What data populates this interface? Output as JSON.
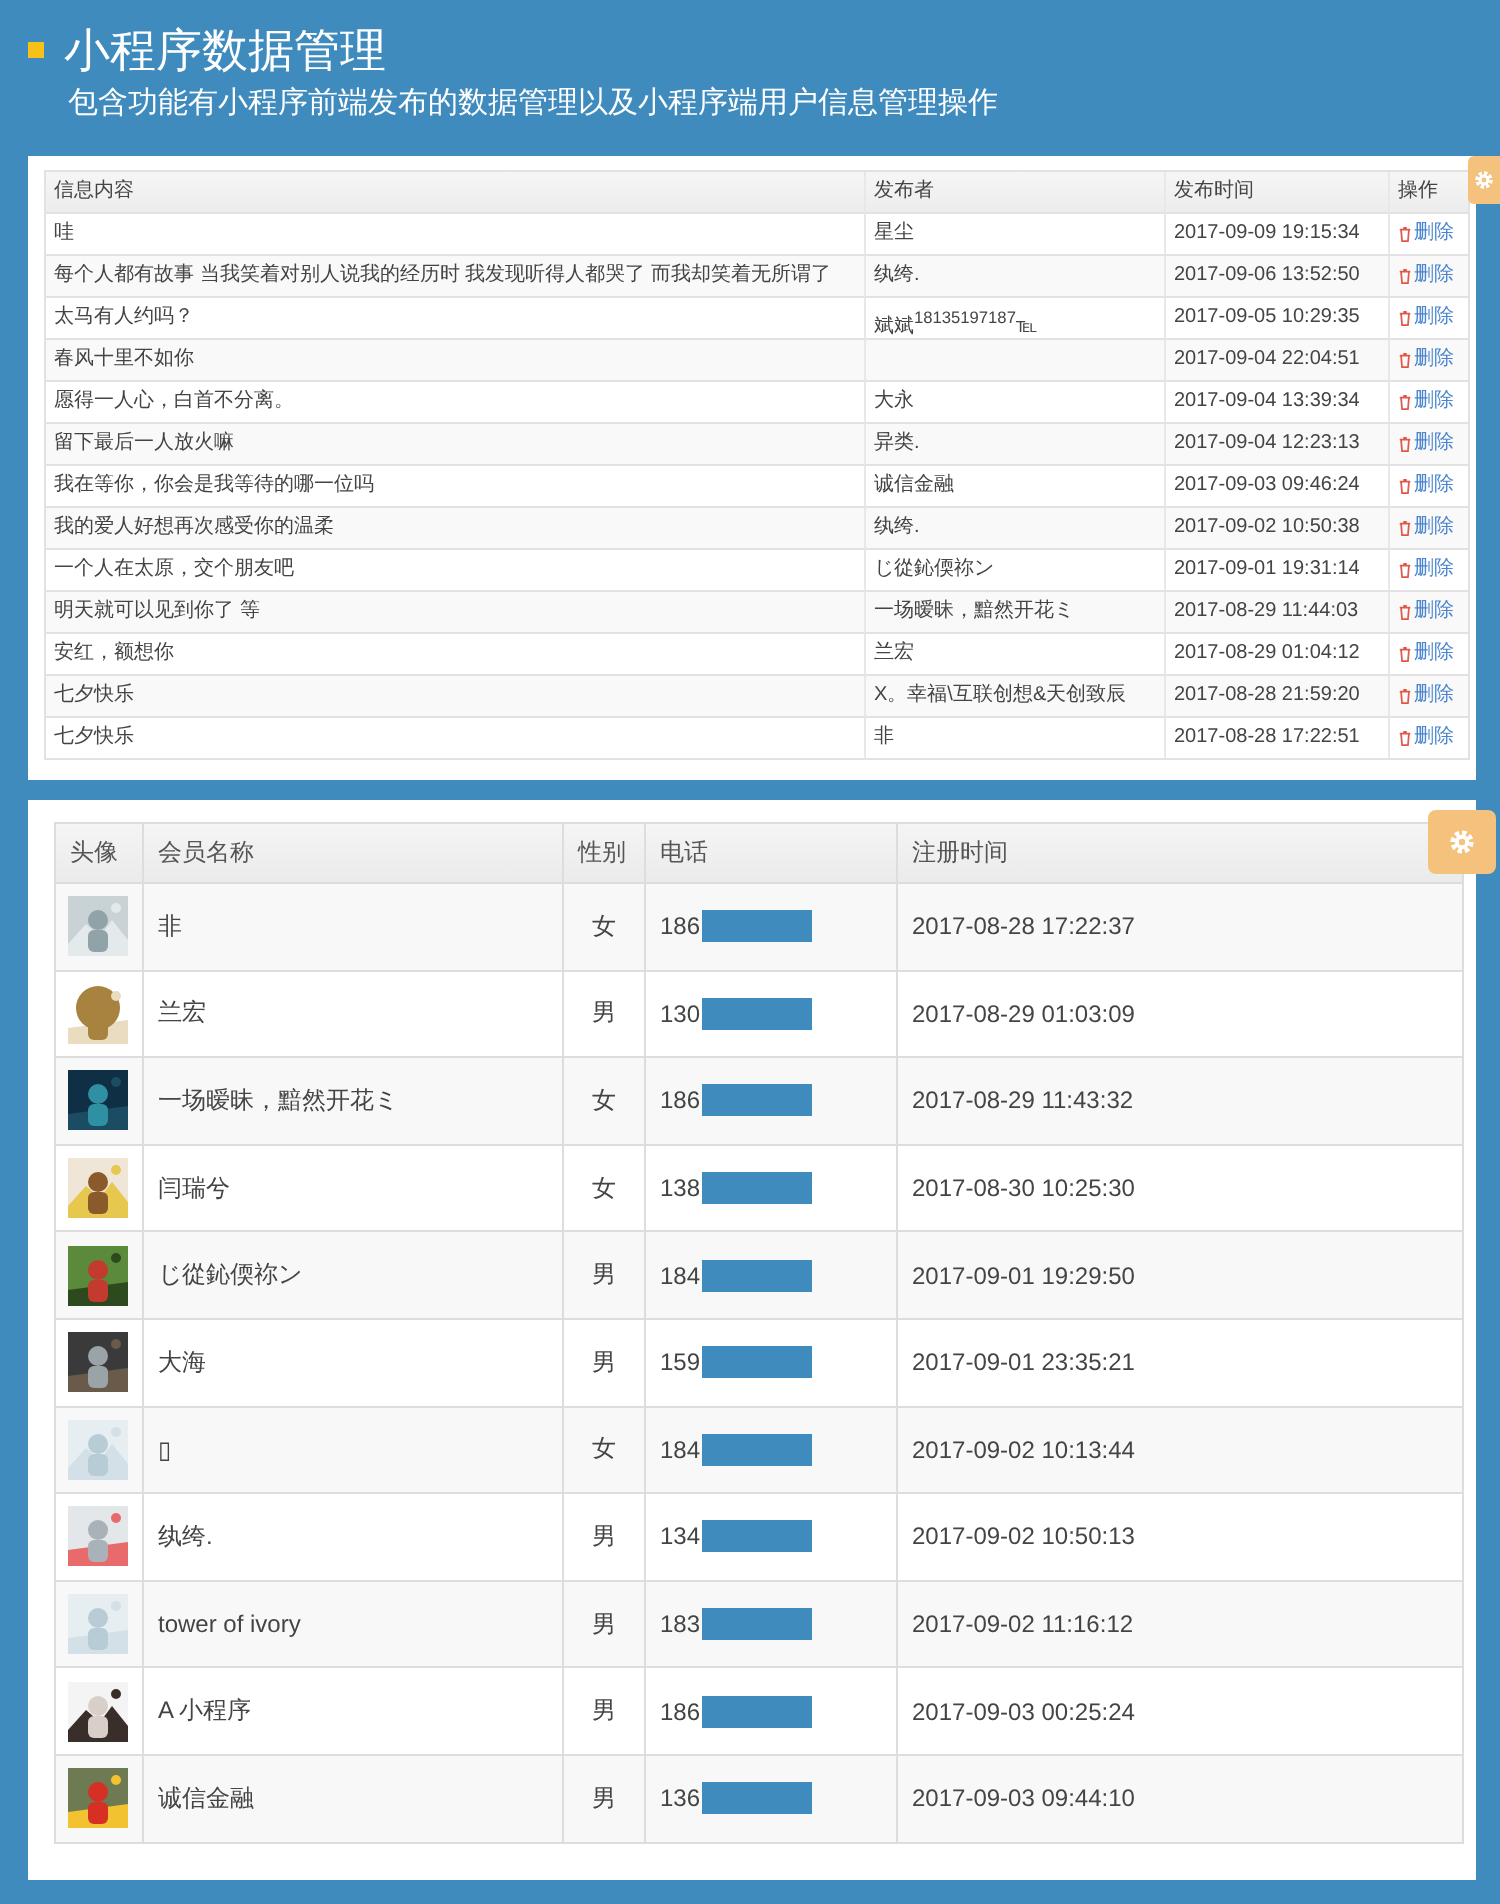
{
  "header": {
    "title": "小程序数据管理",
    "subtitle": "包含功能有小程序前端发布的数据管理以及小程序端用户信息管理操作"
  },
  "posts_table": {
    "columns": [
      "信息内容",
      "发布者",
      "发布时间",
      "操作"
    ],
    "rows": [
      {
        "content": "哇",
        "publisher": "星尘",
        "time": "2017-09-09 19:15:34",
        "action": "删除"
      },
      {
        "content": "每个人都有故事 当我笑着对别人说我的经历时 我发现听得人都哭了 而我却笑着无所谓了",
        "publisher": "纨绔.",
        "time": "2017-09-06 13:52:50",
        "action": "删除"
      },
      {
        "content": "太马有人约吗？",
        "publisher": "斌斌$^{18135197187}$℡",
        "time": "2017-09-05 10:29:35",
        "action": "删除"
      },
      {
        "content": "春风十里不如你",
        "publisher": "",
        "time": "2017-09-04 22:04:51",
        "action": "删除"
      },
      {
        "content": "愿得一人心，白首不分离。",
        "publisher": "大永",
        "time": "2017-09-04 13:39:34",
        "action": "删除"
      },
      {
        "content": "留下最后一人放火嘛",
        "publisher": "异类.",
        "time": "2017-09-04 12:23:13",
        "action": "删除"
      },
      {
        "content": "我在等你，你会是我等待的哪一位吗",
        "publisher": "诚信金融",
        "time": "2017-09-03 09:46:24",
        "action": "删除"
      },
      {
        "content": "我的爱人好想再次感受你的温柔",
        "publisher": "纨绔.",
        "time": "2017-09-02 10:50:38",
        "action": "删除"
      },
      {
        "content": "一个人在太原，交个朋友吧",
        "publisher": "じ從鈊偄祢ン",
        "time": "2017-09-01 19:31:14",
        "action": "删除"
      },
      {
        "content": "明天就可以见到你了 等",
        "publisher": "一场暧昧，黯然开花ミ",
        "time": "2017-08-29 11:44:03",
        "action": "删除"
      },
      {
        "content": "安红，额想你",
        "publisher": "兰宏",
        "time": "2017-08-29 01:04:12",
        "action": "删除"
      },
      {
        "content": "七夕快乐",
        "publisher": "X。幸福\\互联创想&天创致辰",
        "time": "2017-08-28 21:59:20",
        "action": "删除"
      },
      {
        "content": "七夕快乐",
        "publisher": "非",
        "time": "2017-08-28 17:22:51",
        "action": "删除"
      }
    ]
  },
  "members_table": {
    "columns": [
      "头像",
      "会员名称",
      "性别",
      "电话",
      "注册时间"
    ],
    "rows": [
      {
        "name": "非",
        "gender": "女",
        "phone": "186",
        "registered": "2017-08-28 17:22:37"
      },
      {
        "name": "兰宏",
        "gender": "男",
        "phone": "130",
        "registered": "2017-08-29 01:03:09"
      },
      {
        "name": "一场暧昧，黯然开花ミ",
        "gender": "女",
        "phone": "186",
        "registered": "2017-08-29 11:43:32"
      },
      {
        "name": "闫瑞兮",
        "gender": "女",
        "phone": "138",
        "registered": "2017-08-30 10:25:30"
      },
      {
        "name": "じ從鈊偄祢ン",
        "gender": "男",
        "phone": "184",
        "registered": "2017-09-01 19:29:50"
      },
      {
        "name": "大海",
        "gender": "男",
        "phone": "159",
        "registered": "2017-09-01 23:35:21"
      },
      {
        "name": "▯",
        "gender": "女",
        "phone": "184",
        "registered": "2017-09-02 10:13:44"
      },
      {
        "name": "纨绔.",
        "gender": "男",
        "phone": "134",
        "registered": "2017-09-02 10:50:13"
      },
      {
        "name": "tower of ivory",
        "gender": "男",
        "phone": "183",
        "registered": "2017-09-02 11:16:12"
      },
      {
        "name": "A 小程序",
        "gender": "男",
        "phone": "186",
        "registered": "2017-09-03 00:25:24"
      },
      {
        "name": "诚信金融",
        "gender": "男",
        "phone": "136",
        "registered": "2017-09-03 09:44:10"
      }
    ]
  }
}
